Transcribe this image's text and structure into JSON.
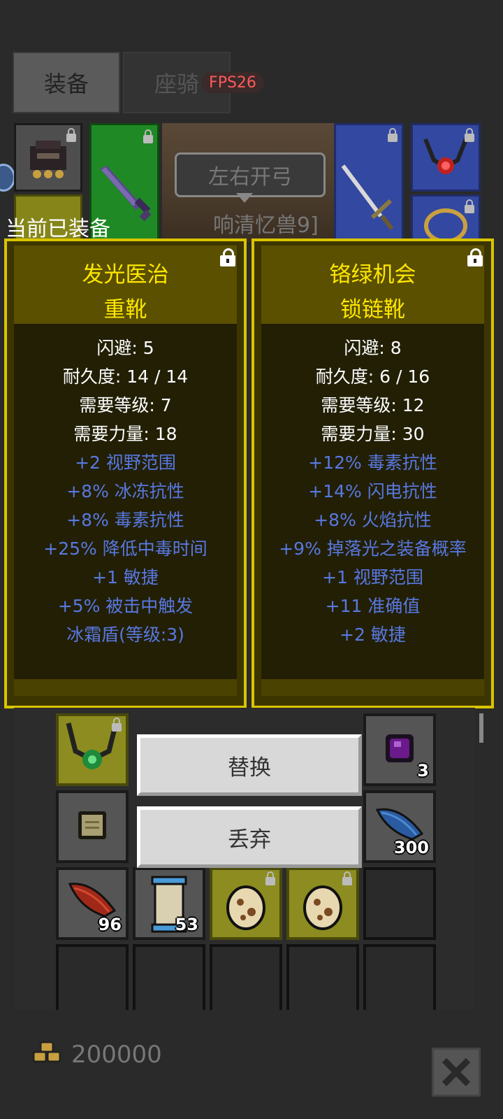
{
  "tabs": [
    {
      "label": "装备"
    },
    {
      "label": "座骑"
    }
  ],
  "fps_label": "FPS26",
  "scene": {
    "dialog_text": "左右开弓",
    "npc_name": "响清忆兽9]"
  },
  "equipped_label": "当前已装备",
  "compare": [
    {
      "name": "发光医治",
      "type": "重靴",
      "base_stats": [
        "闪避: 5",
        "耐久度: 14 / 14",
        "需要等级: 7",
        "需要力量: 18"
      ],
      "bonus_stats": [
        "+2 视野范围",
        "+8% 冰冻抗性",
        "+8% 毒素抗性",
        "+25% 降低中毒时间",
        "+1 敏捷",
        "+5% 被击中触发",
        "冰霜盾(等级:3)"
      ],
      "locked": true
    },
    {
      "name": "铬绿机会",
      "type": "锁链靴",
      "base_stats": [
        "闪避: 8",
        "耐久度: 6 / 16",
        "需要等级: 12",
        "需要力量: 30"
      ],
      "bonus_stats": [
        "+12% 毒素抗性",
        "+14% 闪电抗性",
        "+8% 火焰抗性",
        "+9% 掉落光之装备概率",
        "+1 视野范围",
        "+11 准确值",
        "+2 敏捷"
      ],
      "locked": true
    }
  ],
  "actions": {
    "replace_label": "替换",
    "discard_label": "丢弃"
  },
  "inventory": {
    "counts": {
      "purple_gem": "3",
      "blue_feather": "300",
      "red_feather": "96",
      "scroll": "53"
    }
  },
  "gold": "200000",
  "colors": {
    "card_border": "#d8c400",
    "item_name": "#ffe600",
    "bonus_text": "#5878e0",
    "fps_text": "#ff5a5a"
  }
}
